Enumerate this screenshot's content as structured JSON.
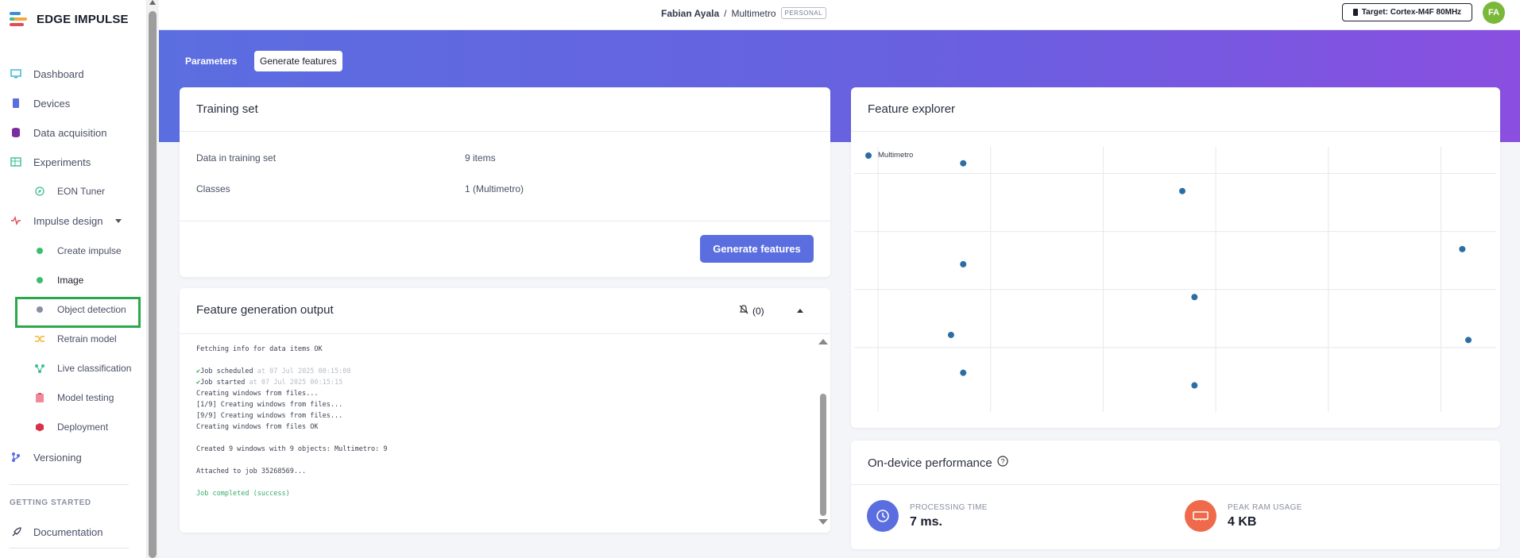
{
  "app": {
    "logo_text": "EDGE IMPULSE"
  },
  "sidebar": {
    "items": [
      {
        "label": "Dashboard"
      },
      {
        "label": "Devices"
      },
      {
        "label": "Data acquisition"
      },
      {
        "label": "Experiments"
      },
      {
        "label": "EON Tuner"
      },
      {
        "label": "Impulse design"
      },
      {
        "label": "Create impulse"
      },
      {
        "label": "Image"
      },
      {
        "label": "Object detection"
      },
      {
        "label": "Retrain model"
      },
      {
        "label": "Live classification"
      },
      {
        "label": "Model testing"
      },
      {
        "label": "Deployment"
      },
      {
        "label": "Versioning"
      }
    ],
    "section_heading": "GETTING STARTED",
    "docs_label": "Documentation"
  },
  "topbar": {
    "owner": "Fabian Ayala",
    "separator": "/",
    "project": "Multimetro",
    "badge": "PERSONAL",
    "target": "Target: Cortex-M4F 80MHz",
    "avatar_initials": "FA"
  },
  "tabs": {
    "parameters": "Parameters",
    "generate": "Generate features"
  },
  "training_set": {
    "title": "Training set",
    "rows": [
      {
        "label": "Data in training set",
        "value": "9 items"
      },
      {
        "label": "Classes",
        "value": "1 (Multimetro)"
      }
    ],
    "button": "Generate features"
  },
  "output": {
    "title": "Feature generation output",
    "notify_count": "(0)",
    "lines": [
      {
        "text": "Fetching info for data items OK"
      },
      {
        "text": ""
      },
      {
        "text": "Job scheduled",
        "ts": " at 07 Jul 2025 00:15:08",
        "check": true
      },
      {
        "text": "Job started",
        "ts": " at 07 Jul 2025 00:15:15",
        "check": true
      },
      {
        "text": "Creating windows from files..."
      },
      {
        "text": "[1/9] Creating windows from files..."
      },
      {
        "text": "[9/9] Creating windows from files..."
      },
      {
        "text": "Creating windows from files OK"
      },
      {
        "text": ""
      },
      {
        "text": "Created 9 windows with 9 objects: Multimetro: 9"
      },
      {
        "text": ""
      },
      {
        "text": "Attached to job 35268569..."
      },
      {
        "text": ""
      },
      {
        "text": "Job completed (success)",
        "ok": true
      }
    ]
  },
  "explorer": {
    "title": "Feature explorer",
    "legend": "Multimetro",
    "series_color": "#2b6ea3"
  },
  "chart_data": {
    "type": "scatter",
    "series": [
      {
        "name": "Multimetro",
        "points": [
          [
            0.12,
            0.28
          ],
          [
            0.14,
            0.96
          ],
          [
            0.14,
            0.56
          ],
          [
            0.14,
            0.13
          ],
          [
            0.5,
            0.85
          ],
          [
            0.52,
            0.43
          ],
          [
            0.52,
            0.08
          ],
          [
            0.96,
            0.62
          ],
          [
            0.97,
            0.26
          ]
        ]
      }
    ],
    "xlim": [
      0,
      1
    ],
    "ylim": [
      0,
      1
    ],
    "grid": true,
    "legend": "top-left"
  },
  "performance": {
    "title": "On-device performance",
    "metrics": [
      {
        "label": "PROCESSING TIME",
        "value": "7 ms.",
        "color": "#5b6ee0"
      },
      {
        "label": "PEAK RAM USAGE",
        "value": "4 KB",
        "color": "#ef6a4a"
      }
    ]
  }
}
